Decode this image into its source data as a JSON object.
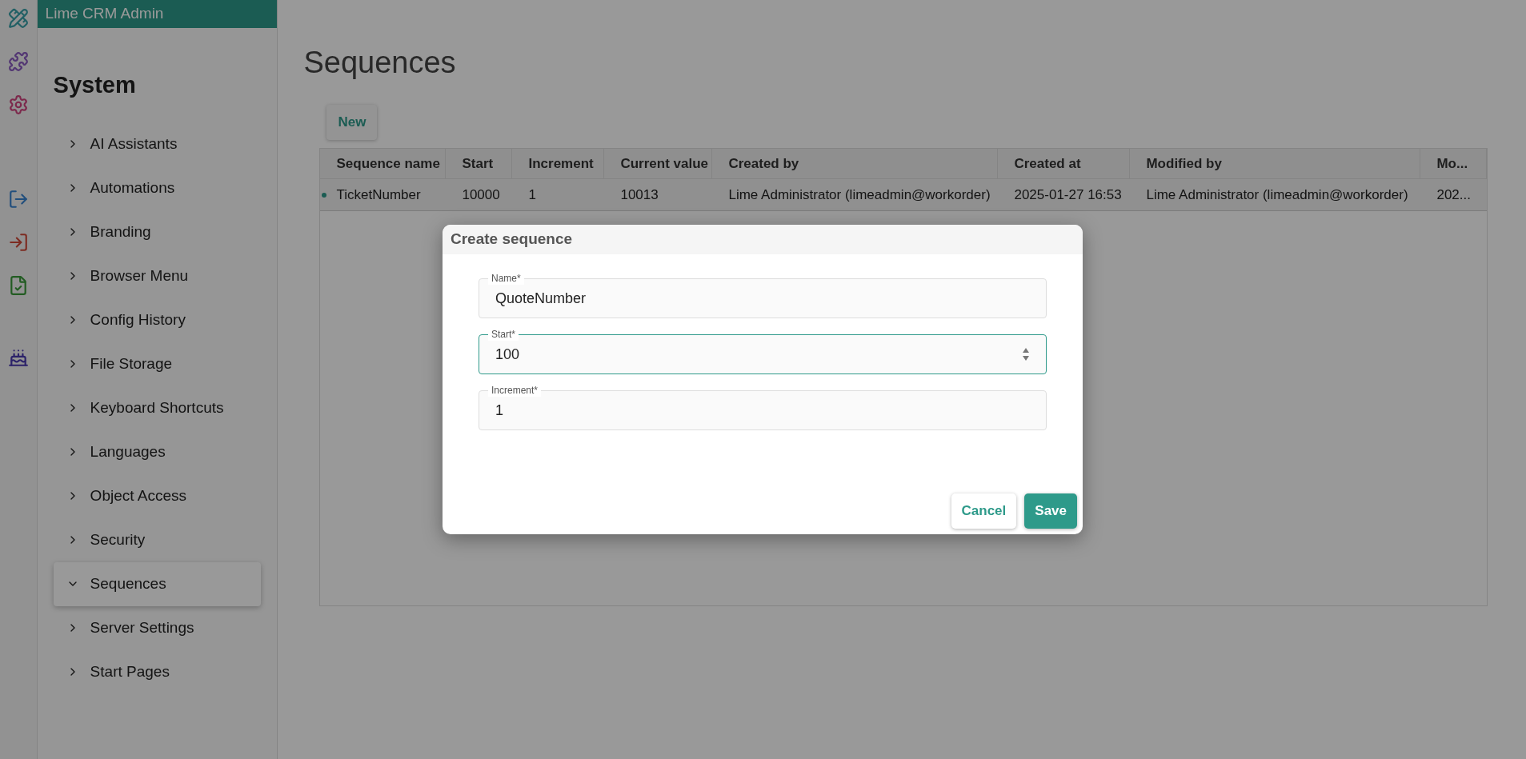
{
  "app_header": {
    "title": "Lime CRM Admin"
  },
  "sidebar": {
    "heading": "System",
    "items": [
      {
        "label": "AI Assistants",
        "selected": false,
        "expanded": false
      },
      {
        "label": "Automations",
        "selected": false,
        "expanded": false
      },
      {
        "label": "Branding",
        "selected": false,
        "expanded": false
      },
      {
        "label": "Browser Menu",
        "selected": false,
        "expanded": false
      },
      {
        "label": "Config History",
        "selected": false,
        "expanded": false
      },
      {
        "label": "File Storage",
        "selected": false,
        "expanded": false
      },
      {
        "label": "Keyboard Shortcuts",
        "selected": false,
        "expanded": false
      },
      {
        "label": "Languages",
        "selected": false,
        "expanded": false
      },
      {
        "label": "Object Access",
        "selected": false,
        "expanded": false
      },
      {
        "label": "Security",
        "selected": false,
        "expanded": false
      },
      {
        "label": "Sequences",
        "selected": true,
        "expanded": true
      },
      {
        "label": "Server Settings",
        "selected": false,
        "expanded": false
      },
      {
        "label": "Start Pages",
        "selected": false,
        "expanded": false
      }
    ]
  },
  "page": {
    "title": "Sequences",
    "new_button": "New"
  },
  "table": {
    "columns": [
      "Sequence name",
      "Start",
      "Increment",
      "Current value",
      "Created by",
      "Created at",
      "Modified by",
      "Mo..."
    ],
    "rows": [
      {
        "selected": true,
        "cells": [
          "TicketNumber",
          "10000",
          "1",
          "10013",
          "Lime Administrator (limeadmin@workorder)",
          "2025-01-27 16:53",
          "Lime Administrator (limeadmin@workorder)",
          "202..."
        ]
      }
    ]
  },
  "dialog": {
    "title": "Create sequence",
    "fields": [
      {
        "label": "Name*",
        "value": "QuoteNumber",
        "kind": "text",
        "focused": false
      },
      {
        "label": "Start*",
        "value": "100",
        "kind": "number",
        "focused": true
      },
      {
        "label": "Increment*",
        "value": "1",
        "kind": "text",
        "focused": false
      }
    ],
    "buttons": [
      {
        "label": "Cancel",
        "kind": "secondary"
      },
      {
        "label": "Save",
        "kind": "primary"
      }
    ]
  }
}
